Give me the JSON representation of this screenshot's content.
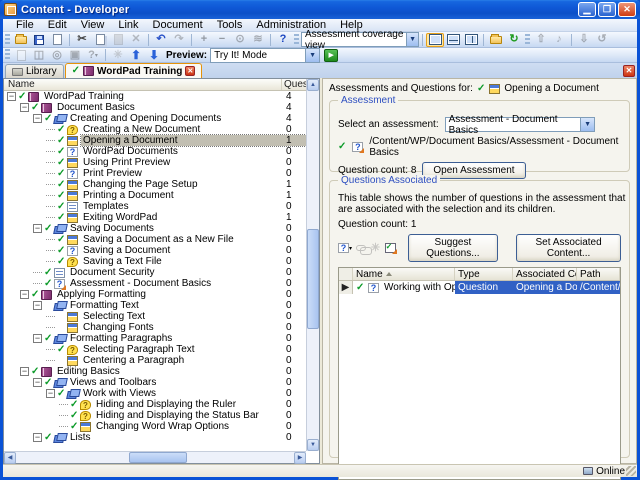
{
  "window": {
    "title": "Content - Developer"
  },
  "menu": {
    "items": [
      "File",
      "Edit",
      "View",
      "Link",
      "Document",
      "Tools",
      "Administration",
      "Help"
    ]
  },
  "toolbar": {
    "view_combo": "Assessment coverage view",
    "preview_label": "Preview:",
    "preview_combo": "Try It! Mode"
  },
  "tabs": {
    "library": "Library",
    "content": "WordPad Training"
  },
  "tree": {
    "header_name": "Name",
    "header_questions": "Quest",
    "items": [
      {
        "label": "WordPad Training",
        "level": 0,
        "count": 4,
        "icon": "book",
        "check": true,
        "exp": "-"
      },
      {
        "label": "Document Basics",
        "level": 1,
        "count": 4,
        "icon": "book",
        "check": true,
        "exp": "-"
      },
      {
        "label": "Creating and Opening Documents",
        "level": 2,
        "count": 4,
        "icon": "books",
        "check": true,
        "exp": "-"
      },
      {
        "label": "Creating a New Document",
        "level": 3,
        "count": 0,
        "icon": "bubble",
        "check": true
      },
      {
        "label": "Opening a Document",
        "level": 3,
        "count": 1,
        "icon": "sim",
        "check": true,
        "selected": true
      },
      {
        "label": "WordPad Documents",
        "level": 3,
        "count": 0,
        "icon": "qdoc",
        "check": true
      },
      {
        "label": "Using Print Preview",
        "level": 3,
        "count": 0,
        "icon": "sim",
        "check": true
      },
      {
        "label": "Print Preview",
        "level": 3,
        "count": 0,
        "icon": "qdoc",
        "check": true
      },
      {
        "label": "Changing the Page Setup",
        "level": 3,
        "count": 1,
        "icon": "sim",
        "check": true
      },
      {
        "label": "Printing a Document",
        "level": 3,
        "count": 1,
        "icon": "sim",
        "check": true
      },
      {
        "label": "Templates",
        "level": 3,
        "count": 0,
        "icon": "doc",
        "check": true
      },
      {
        "label": "Exiting WordPad",
        "level": 3,
        "count": 1,
        "icon": "sim",
        "check": true
      },
      {
        "label": "Saving Documents",
        "level": 2,
        "count": 0,
        "icon": "books",
        "check": true,
        "exp": "-"
      },
      {
        "label": "Saving a Document as a New File",
        "level": 3,
        "count": 0,
        "icon": "sim",
        "check": true
      },
      {
        "label": "Saving a Document",
        "level": 3,
        "count": 0,
        "icon": "qdoc",
        "check": true
      },
      {
        "label": "Saving a Text File",
        "level": 3,
        "count": 0,
        "icon": "bubble",
        "check": true
      },
      {
        "label": "Document Security",
        "level": 2,
        "count": 0,
        "icon": "doc",
        "check": true
      },
      {
        "label": "Assessment - Document Basics",
        "level": 2,
        "count": 0,
        "icon": "assess",
        "check": true
      },
      {
        "label": "Applying Formatting",
        "level": 1,
        "count": 0,
        "icon": "book",
        "check": true,
        "exp": "-"
      },
      {
        "label": "Formatting Text",
        "level": 2,
        "count": 0,
        "icon": "books",
        "check": false,
        "exp": "-"
      },
      {
        "label": "Selecting Text",
        "level": 3,
        "count": 0,
        "icon": "sim",
        "check": false
      },
      {
        "label": "Changing Fonts",
        "level": 3,
        "count": 0,
        "icon": "sim",
        "check": false
      },
      {
        "label": "Formatting Paragraphs",
        "level": 2,
        "count": 0,
        "icon": "books",
        "check": true,
        "exp": "-"
      },
      {
        "label": "Selecting Paragraph Text",
        "level": 3,
        "count": 0,
        "icon": "bubble",
        "check": true
      },
      {
        "label": "Centering a Paragraph",
        "level": 3,
        "count": 0,
        "icon": "sim",
        "check": false
      },
      {
        "label": "Editing Basics",
        "level": 1,
        "count": 0,
        "icon": "book",
        "check": true,
        "exp": "-"
      },
      {
        "label": "Views and Toolbars",
        "level": 2,
        "count": 0,
        "icon": "books",
        "check": true,
        "exp": "-"
      },
      {
        "label": "Work with Views",
        "level": 3,
        "count": 0,
        "icon": "books",
        "check": true,
        "exp": "-"
      },
      {
        "label": "Hiding and Displaying the Ruler",
        "level": 4,
        "count": 0,
        "icon": "bubble",
        "check": true
      },
      {
        "label": "Hiding and Displaying the Status Bar",
        "level": 4,
        "count": 0,
        "icon": "bubble",
        "check": true
      },
      {
        "label": "Changing Word Wrap Options",
        "level": 4,
        "count": 0,
        "icon": "sim",
        "check": true
      },
      {
        "label": "Lists",
        "level": 2,
        "count": 0,
        "icon": "books",
        "check": true,
        "exp": "-"
      }
    ]
  },
  "panel": {
    "header_prefix": "Assessments and Questions for:",
    "header_item": "Opening a Document",
    "assessment": {
      "group_label": "Assessment",
      "select_label": "Select an assessment:",
      "selected_assessment": "Assessment - Document Basics",
      "path": "/Content/WP/Document Basics/Assessment - Document Basics",
      "question_count": "Question count: 8",
      "open_button": "Open Assessment"
    },
    "questions": {
      "group_label": "Questions Associated",
      "description": "This table shows the number of questions in the assessment that are associated with the selection and its children.",
      "question_count": "Question count: 1",
      "suggest_button": "Suggest Questions...",
      "set_button": "Set Associated Content...",
      "table": {
        "columns": [
          "Name",
          "Type",
          "Associated Co...",
          "Path"
        ],
        "rows": [
          {
            "name": "Working with Open D",
            "type": "Question",
            "associated": "Opening a Doc...",
            "path": "/Content/Questions and..."
          }
        ]
      }
    }
  },
  "statusbar": {
    "online": "Online"
  }
}
